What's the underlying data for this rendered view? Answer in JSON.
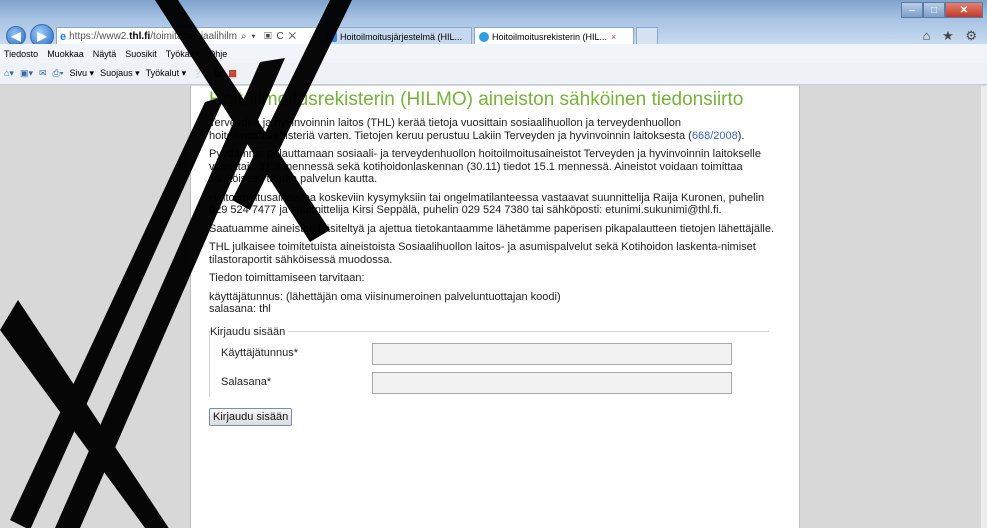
{
  "browser": {
    "address_url_prefix": "https://www2.",
    "address_url_domain": "thl.fi",
    "address_url_path": "/toimita/sosiaalihilm",
    "address_tools": "⌕ ▾  ▣ C ✕",
    "tabs": [
      {
        "label": "Hoitoilmoitusjärjestelmä (HIL..."
      },
      {
        "label": "Hoitoilmoitusrekisterin (HIL..."
      }
    ],
    "tab_close": "×",
    "right_icons": "⌂ ★ ⚙"
  },
  "menu": [
    "Tiedosto",
    "Muokkaa",
    "Näytä",
    "Suosikit",
    "Työkalut",
    "Ohje"
  ],
  "command_bar": {
    "sivu": "Sivu ▾",
    "suojaus": "Suojaus ▾",
    "tyokalut": "Työkalut ▾"
  },
  "page": {
    "title": "Hoitoilmoitusrekisterin (HILMO) aineiston sähköinen tiedonsiirto",
    "p1_text": "Terveyden ja hyvinvoinnin laitos (THL) kerää tietoja vuosittain sosiaalihuollon ja terveydenhuollon hoitoilmoitusrekisteriä varten. Tietojen keruu perustuu Lakiin Terveyden ja hyvinvoinnin laitoksesta (",
    "p1_link": "668/2008",
    "p1_end": ").",
    "p2": "Pyydämme palauttamaan sosiaali- ja terveydenhuollon hoitoilmoitusaineistot Terveyden ja hyvinvoinnin laitokselle vuosittain 31.3 mennessä sekä kotihoidonlaskennan (30.11) tiedot 15.1 mennessä. Aineistot voidaan toimittaa sähköisesti tämän palvelun kautta.",
    "p3": "Hoitoilmoitusaineistoa koskeviin kysymyksiin tai ongelmatilanteessa vastaavat suunnittelija Raija Kuronen, puhelin 029 524 7477 ja suunnittelija Kirsi Seppälä, puhelin 029 524 7380 tai sähköposti: etunimi.sukunimi@thl.fi.",
    "p4": "Saatuamme aineiston käsiteltyä ja ajettua tietokantaamme lähetämme paperisen pikapalautteen tietojen lähettäjälle.",
    "p5": "THL julkaisee toimitetuista aineistoista Sosiaalihuollon laitos- ja asumispalvelut sekä Kotihoidon laskenta-nimiset tilastoraportit sähköisessä muodossa.",
    "p6": "Tiedon toimittamiseen tarvitaan:",
    "p7_line1": "käyttäjätunnus: (lähettäjän oma viisinumeroinen palveluntuottajan koodi)",
    "p7_line2": "salasana: thl"
  },
  "login": {
    "legend": "Kirjaudu sisään",
    "username_label": "Käyttäjätunnus*",
    "username_value": "",
    "password_label": "Salasana*",
    "password_value": "",
    "submit_label": "Kirjaudu sisään"
  }
}
